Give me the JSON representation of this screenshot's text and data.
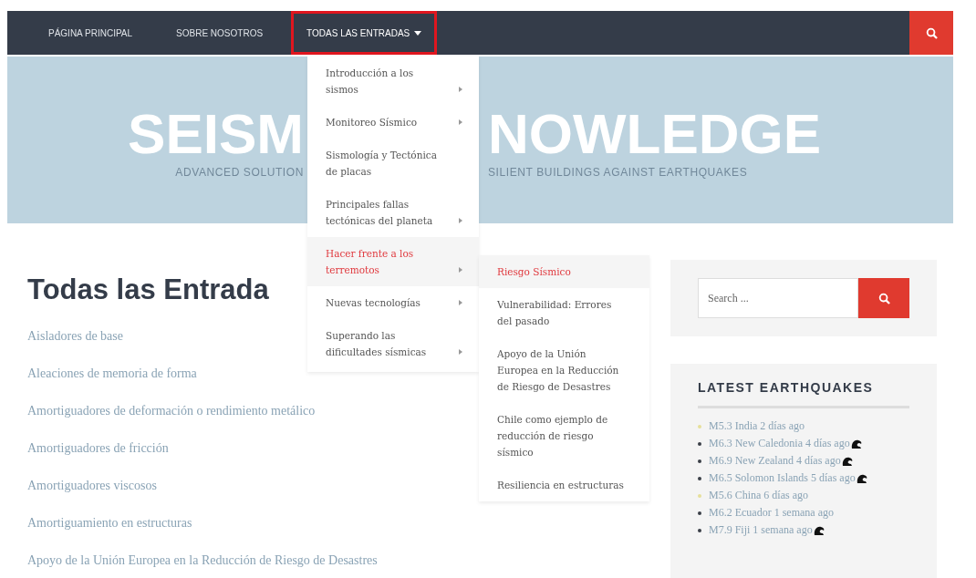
{
  "nav": {
    "items": [
      {
        "label": "PÁGINA PRINCIPAL",
        "selected": false,
        "caret": false
      },
      {
        "label": "SOBRE NOSOTROS",
        "selected": false,
        "caret": false
      },
      {
        "label": "TODAS LAS ENTRADAS",
        "selected": true,
        "caret": true
      }
    ]
  },
  "banner": {
    "title_left": "SEISM",
    "title_right": "NOWLEDGE",
    "tagline_left": "ADVANCED SOLUTION",
    "tagline_right": "SILIENT BUILDINGS AGAINST EARTHQUAKES"
  },
  "dropdown": {
    "items": [
      {
        "label": "Introducción a los sismos",
        "submenu": true,
        "selected": false
      },
      {
        "label": "Monitoreo Sísmico",
        "submenu": true,
        "selected": false
      },
      {
        "label": "Sismología y Tectónica de placas",
        "submenu": false,
        "selected": false
      },
      {
        "label": "Principales fallas tectónicas del planeta",
        "submenu": true,
        "selected": false
      },
      {
        "label": "Hacer frente a los terremotos",
        "submenu": true,
        "selected": true
      },
      {
        "label": "Nuevas tecnologías",
        "submenu": true,
        "selected": false
      },
      {
        "label": "Superando las dificultades sísmicas",
        "submenu": true,
        "selected": false
      }
    ]
  },
  "submenu": {
    "items": [
      {
        "label": "Riesgo Sísmico",
        "selected": true
      },
      {
        "label": "Vulnerabilidad: Errores del pasado",
        "selected": false
      },
      {
        "label": "Apoyo de la Unión Europea en la Reducción de Riesgo de Desastres",
        "selected": false
      },
      {
        "label": "Chile como ejemplo de reducción de riesgo sísmico",
        "selected": false
      },
      {
        "label": "Resiliencia en estructuras",
        "selected": false
      }
    ]
  },
  "main": {
    "heading": "Todas las Entrada",
    "posts": [
      "Aisladores de base",
      "Aleaciones de memoria de forma",
      "Amortiguadores de deformación o rendimiento metálico",
      "Amortiguadores de fricción",
      "Amortiguadores viscosos",
      "Amortiguamiento en estructuras",
      "Apoyo de la Unión Europea en la Reducción de Riesgo de Desastres"
    ]
  },
  "sidebar": {
    "search": {
      "placeholder": "Search ..."
    },
    "quakes_title": "LATEST EARTHQUAKES",
    "quakes": [
      {
        "text": "M5.3 India 2 días ago",
        "color": "#e6df9a",
        "tsunami": false
      },
      {
        "text": "M6.3 New Caledonia 4 días ago",
        "color": "#3a3f47",
        "tsunami": true
      },
      {
        "text": "M6.9 New Zealand 4 días ago",
        "color": "#3a3f47",
        "tsunami": true
      },
      {
        "text": "M6.5 Solomon Islands 5 días ago",
        "color": "#3a3f47",
        "tsunami": true
      },
      {
        "text": "M5.6 China 6 días ago",
        "color": "#e6df9a",
        "tsunami": false
      },
      {
        "text": "M6.2 Ecuador 1 semana ago",
        "color": "#3a3f47",
        "tsunami": false
      },
      {
        "text": "M7.9 Fiji 1 semana ago",
        "color": "#3a3f47",
        "tsunami": true
      }
    ]
  }
}
